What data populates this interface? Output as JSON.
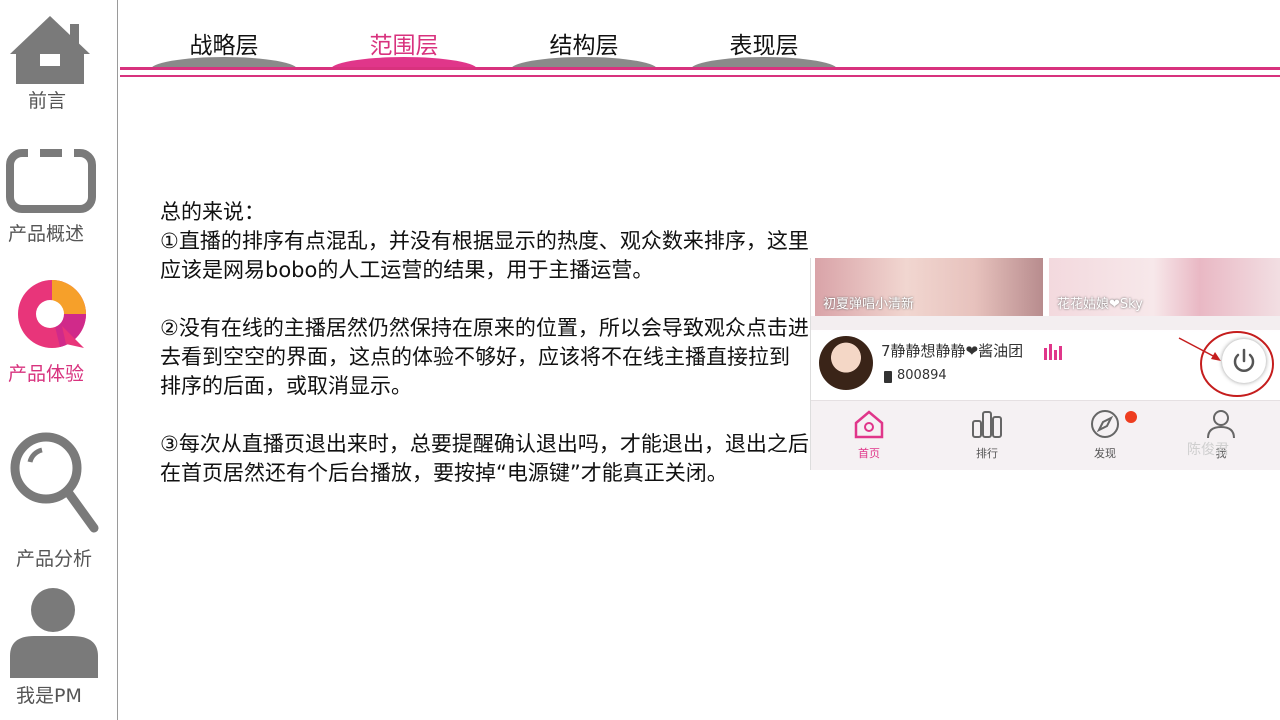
{
  "sidebar": {
    "items": [
      {
        "label": "前言",
        "icon": "home-icon"
      },
      {
        "label": "产品概述",
        "icon": "tv-icon"
      },
      {
        "label": "产品体验",
        "icon": "app-logo-icon"
      },
      {
        "label": "产品分析",
        "icon": "magnifier-icon"
      },
      {
        "label": "我是PM",
        "icon": "person-icon"
      }
    ],
    "active_index": 2
  },
  "tabs": {
    "items": [
      "战略层",
      "范围层",
      "结构层",
      "表现层"
    ],
    "active_index": 1
  },
  "colors": {
    "accent": "#d8327e",
    "inactive_tab": "#8a8a8a",
    "sidebar_text": "#555555"
  },
  "content": {
    "heading": "总的来说：",
    "point1": "①直播的排序有点混乱，并没有根据显示的热度、观众数来排序，这里应该是网易bobo的人工运营的结果，用于主播运营。",
    "point2": "②没有在线的主播居然仍然保持在原来的位置，所以会导致观众点击进去看到空空的界面，这点的体验不够好，应该将不在线主播直接拉到排序的后面，或取消显示。",
    "point3": "③每次从直播页退出来时，总要提醒确认退出吗，才能退出，退出之后在首页居然还有个后台播放，要按掉“电源键”才能真正关闭。"
  },
  "screenshot": {
    "thumb_left_caption": "初夏弹唱小清新",
    "thumb_right_caption": "花花姑娘❤Sky",
    "live_anchor_name": "7静静想静静❤酱油团",
    "live_room_id": "800894",
    "nav": [
      {
        "label": "首页",
        "icon": "home-outline-icon"
      },
      {
        "label": "排行",
        "icon": "ranking-icon"
      },
      {
        "label": "发现",
        "icon": "compass-icon"
      },
      {
        "label": "我",
        "icon": "user-outline-icon"
      }
    ],
    "active_nav_index": 0,
    "watermark": "陈俊君"
  }
}
